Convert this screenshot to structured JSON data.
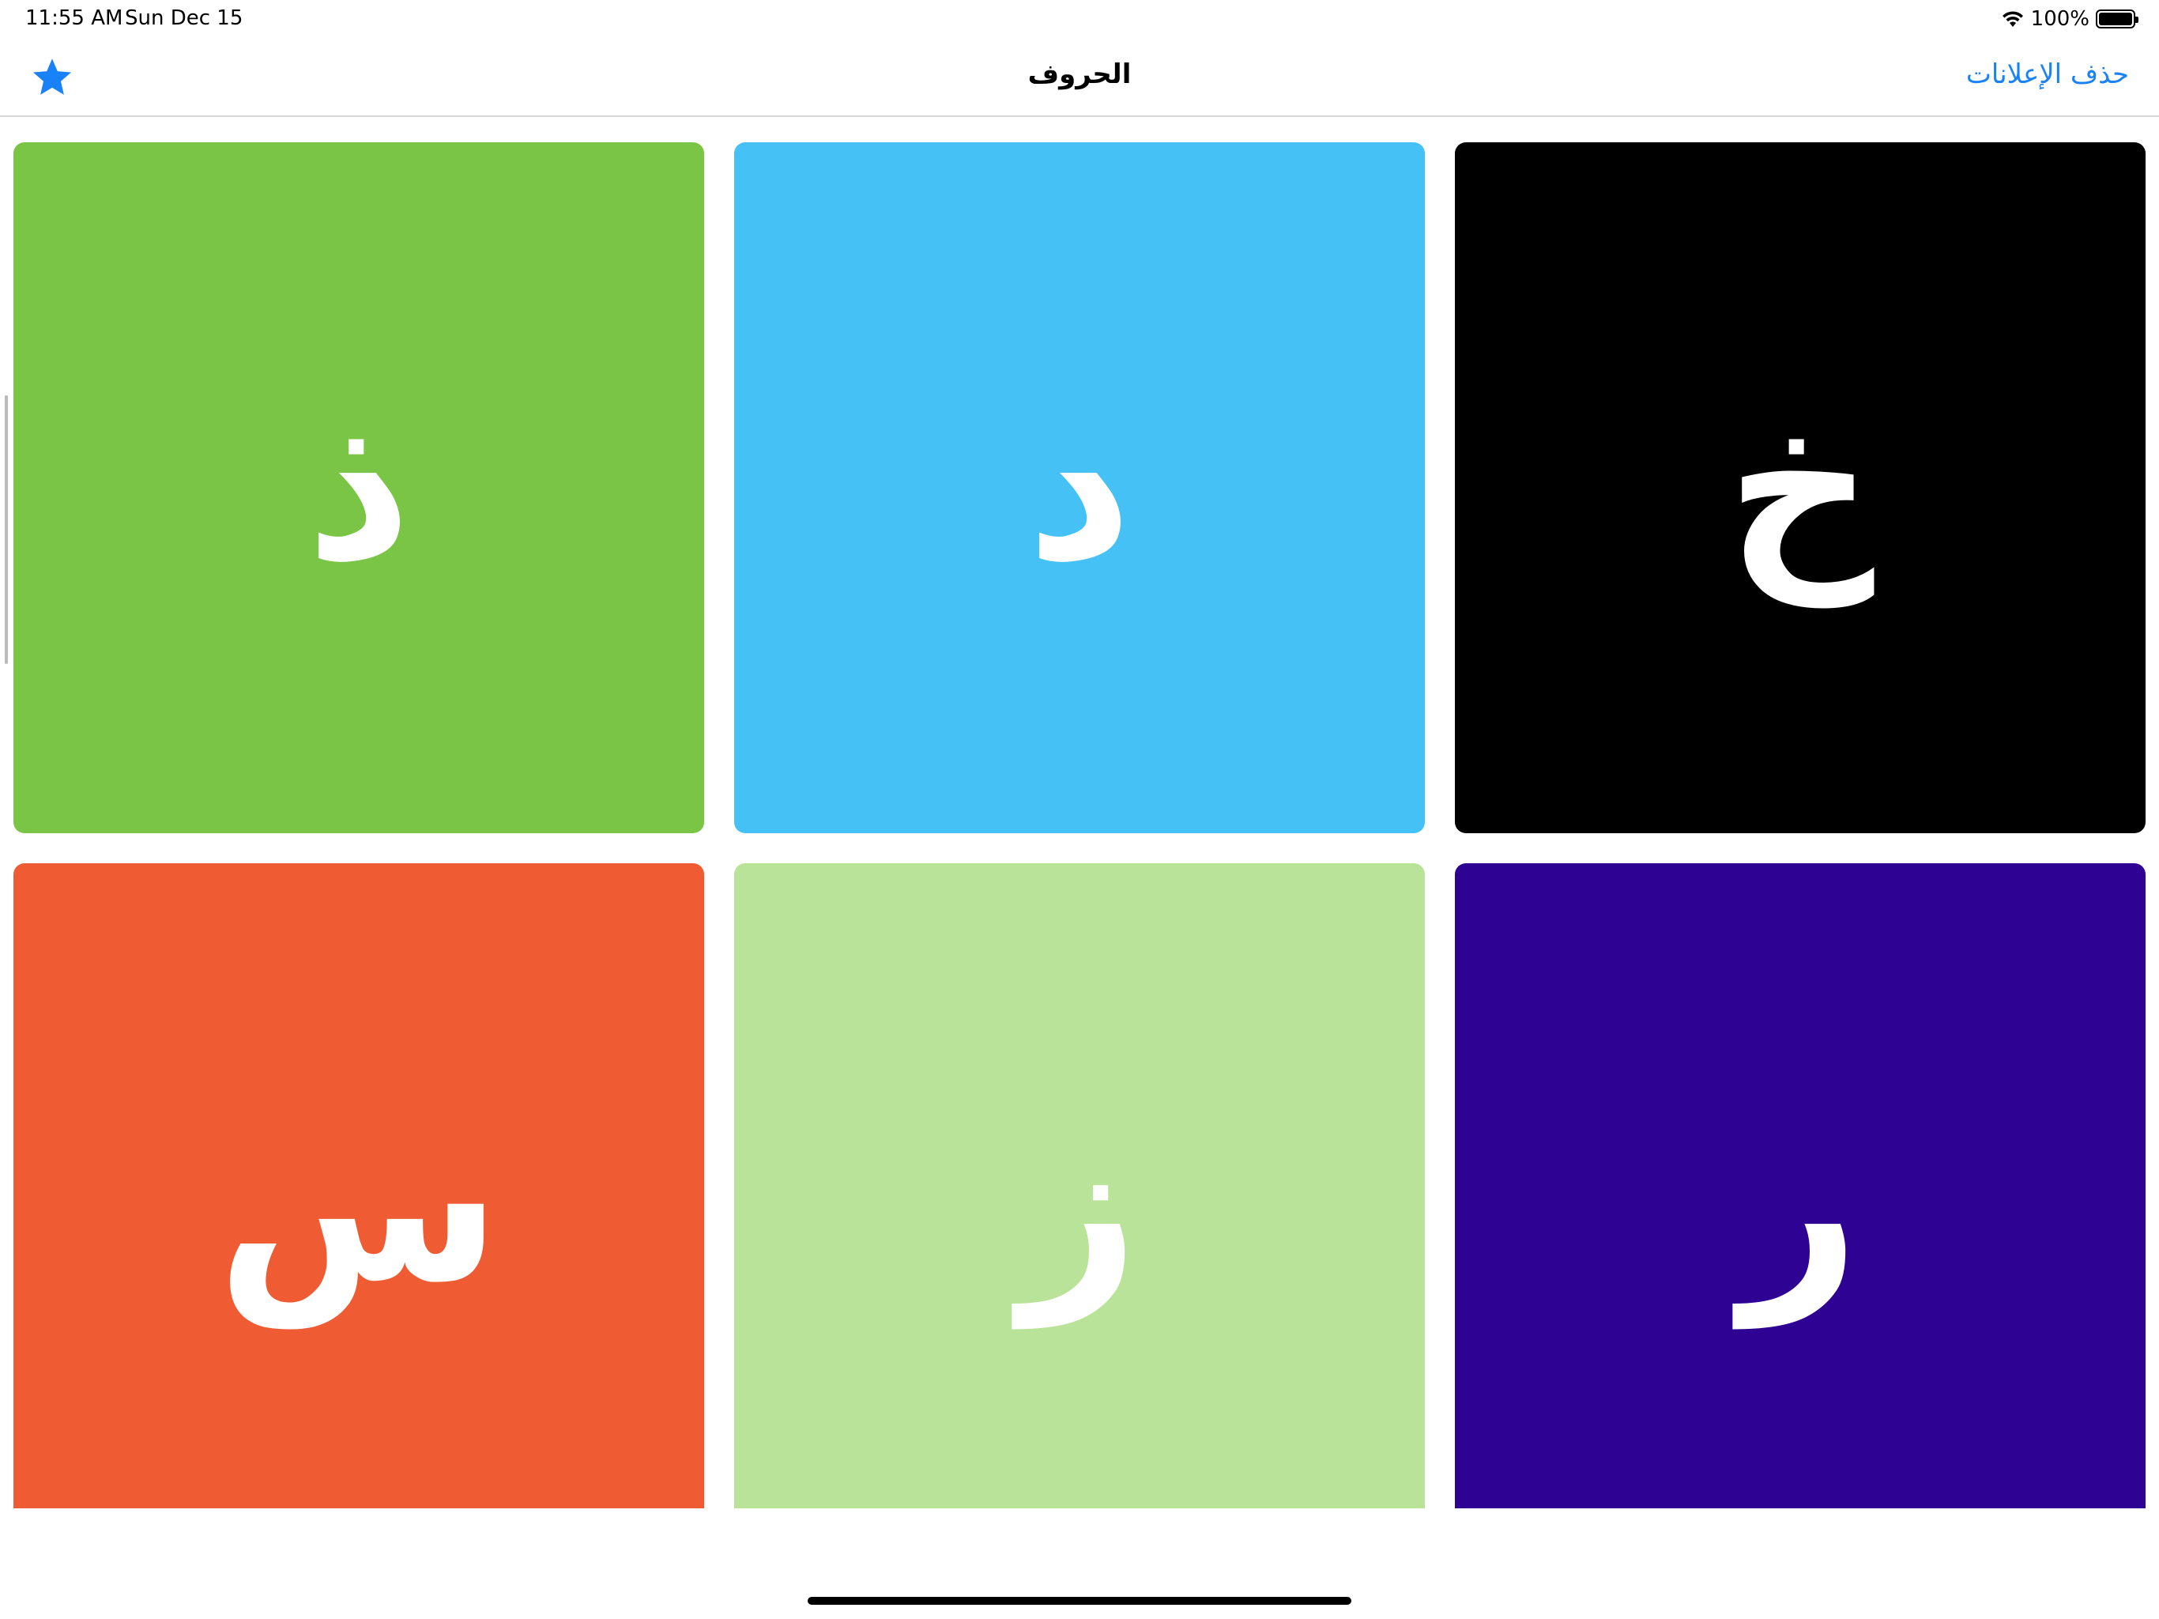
{
  "status_bar": {
    "time": "11:55 AM",
    "date": "Sun Dec 15",
    "battery_percent": "100%",
    "battery_level": 1.0,
    "wifi_icon": "wifi-icon"
  },
  "nav": {
    "title": "الحروف",
    "favorite_icon": "star-icon",
    "favorite_color": "#1a82f8",
    "remove_ads_label": "حذف الإعلانات",
    "accent_color": "#1a82f8"
  },
  "cards": [
    {
      "letter": "ذ",
      "color": "#7ac546"
    },
    {
      "letter": "د",
      "color": "#45c1f5"
    },
    {
      "letter": "خ",
      "color": "#000000"
    },
    {
      "letter": "س",
      "color": "#ef5b33"
    },
    {
      "letter": "ز",
      "color": "#b9e398"
    },
    {
      "letter": "ر",
      "color": "#2e0292"
    }
  ]
}
